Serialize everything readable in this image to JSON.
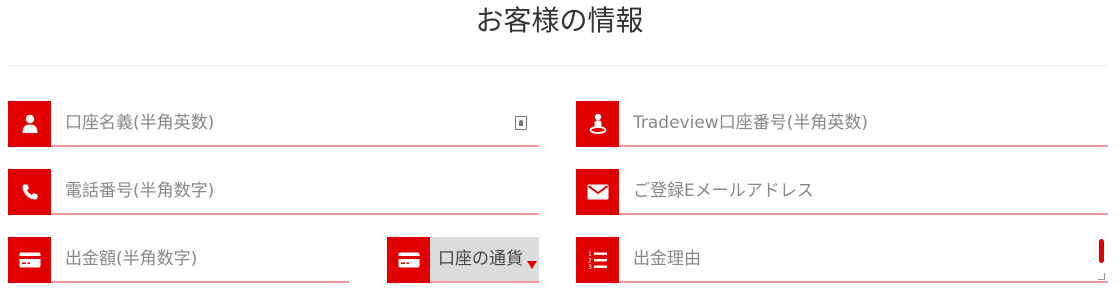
{
  "page": {
    "title": "お客様の情報"
  },
  "fields": {
    "account_name": {
      "placeholder": "口座名義(半角英数)",
      "icon": "user-icon"
    },
    "tradeview_account": {
      "placeholder": "Tradeview口座番号(半角英数)",
      "icon": "person-pin-icon"
    },
    "phone": {
      "placeholder": "電話番号(半角数字)",
      "icon": "phone-icon"
    },
    "email": {
      "placeholder": "ご登録Eメールアドレス",
      "icon": "envelope-icon"
    },
    "amount": {
      "placeholder": "出金額(半角数字)",
      "icon": "credit-card-icon"
    },
    "currency": {
      "selected": "口座の通貨",
      "icon": "credit-card-icon"
    },
    "reason": {
      "placeholder": "出金理由",
      "icon": "numbered-list-icon"
    }
  },
  "colors": {
    "accent": "#e00000",
    "underline": "#f19a9a",
    "placeholder": "#888888",
    "select_bg": "#dcdcdc"
  }
}
